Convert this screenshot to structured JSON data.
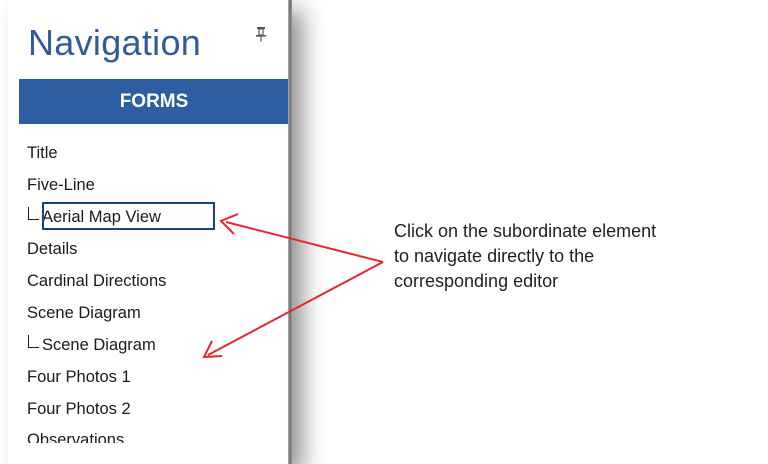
{
  "panel": {
    "title": "Navigation",
    "section_header": "FORMS",
    "items": [
      {
        "label": "Title",
        "sub": false
      },
      {
        "label": "Five-Line",
        "sub": false
      },
      {
        "label": "Aerial Map View",
        "sub": true,
        "highlighted": true
      },
      {
        "label": "Details",
        "sub": false
      },
      {
        "label": "Cardinal Directions",
        "sub": false
      },
      {
        "label": "Scene Diagram",
        "sub": false
      },
      {
        "label": "Scene Diagram",
        "sub": true
      },
      {
        "label": "Four Photos 1",
        "sub": false
      },
      {
        "label": "Four Photos 2",
        "sub": false
      },
      {
        "label": "Observations",
        "sub": false
      }
    ]
  },
  "annotation": {
    "text_lines": [
      "Click on the subordinate element",
      "to navigate directly to the",
      "corresponding editor"
    ],
    "arrow_color": "#e8262a"
  },
  "colors": {
    "title": "#2f5c9c",
    "header_bg": "#2d5ea2",
    "highlight_border": "#1b3f8f"
  },
  "icons": {
    "pin": "pin-icon"
  }
}
